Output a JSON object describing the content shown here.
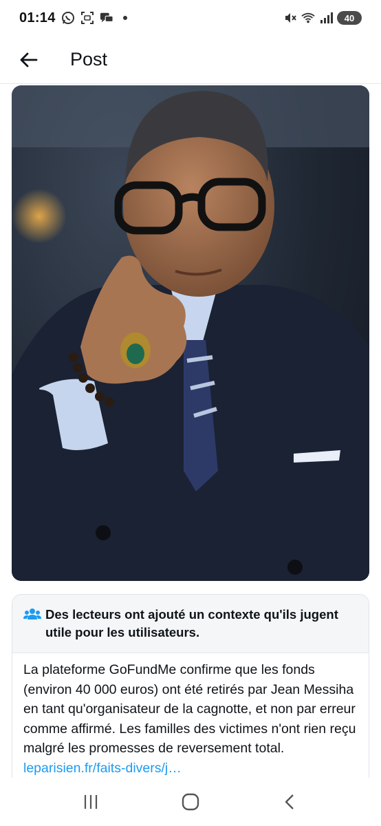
{
  "status_bar": {
    "time": "01:14",
    "battery": "40",
    "icons": [
      "whatsapp-icon",
      "screenshot-icon",
      "chat-icon",
      "notification-dot-icon",
      "mute-icon",
      "wifi-icon",
      "signal-icon",
      "battery-icon"
    ]
  },
  "header": {
    "title": "Post",
    "back_icon": "arrow-left-icon"
  },
  "post": {
    "image_description_icon": "photo"
  },
  "community_note": {
    "icon": "people-icon",
    "heading": "Des lecteurs ont ajouté un contexte qu'ils jugent utile pour les utilisateurs.",
    "body": "La plateforme GoFundMe confirme que les fonds (environ 40 000 euros) ont été retirés par Jean Messiha en tant qu'organisateur de la cagnotte, et non par erreur comme affirmé. Les familles des victimes n'ont rien reçu malgré les promesses de reversement total. ",
    "link": "leparisien.fr/faits-divers/j…",
    "accent_color": "#1d9bf0"
  },
  "nav_bar": {
    "recent_icon": "recent-apps-icon",
    "home_icon": "home-icon",
    "back_icon": "back-icon"
  }
}
